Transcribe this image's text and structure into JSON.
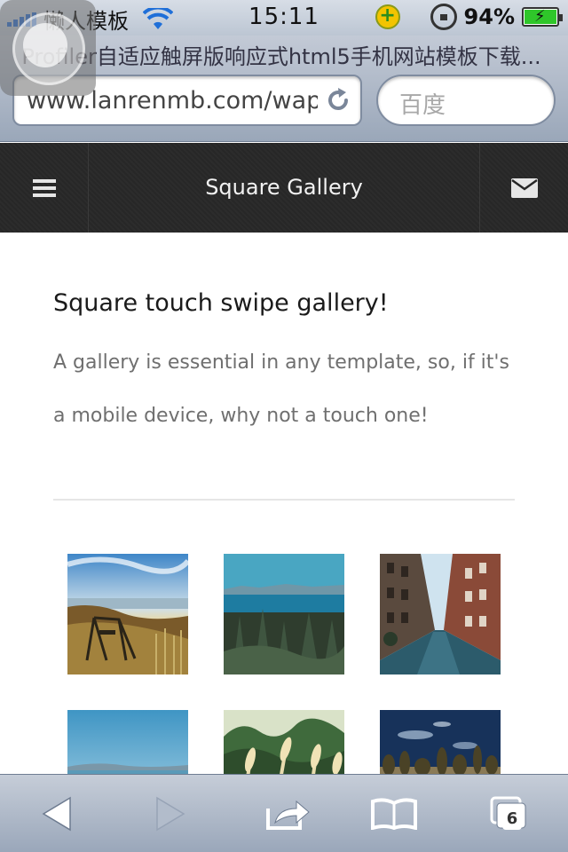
{
  "status_bar": {
    "carrier": "懒人模板",
    "time": "15:11",
    "battery": "94%"
  },
  "browser": {
    "page_title": "Profiler自适应触屏版响应式html5手机网站模板下载...",
    "url": "www.lanrenmb.com/wap",
    "search_placeholder": "百度",
    "tabs_count": "6"
  },
  "header": {
    "title": "Square Gallery",
    "menu_icon": "menu-icon",
    "mail_icon": "mail-icon"
  },
  "main": {
    "heading": "Square touch swipe gallery!",
    "description": "A gallery is essential in any template, so, if it's a mobile device, why not a touch one!"
  },
  "gallery": {
    "items": [
      {
        "subject": "swing on grassy coast at sunset"
      },
      {
        "subject": "lake and pine forest"
      },
      {
        "subject": "city street between brick buildings"
      },
      {
        "subject": "sea horizon under blue sky"
      },
      {
        "subject": "grass stalks against blurred trees"
      },
      {
        "subject": "trees under dark blue sky"
      }
    ]
  },
  "colors": {
    "header_bg": "#272727",
    "toolbar_blue": "#9aa7ba",
    "body_text": "#6f6f6f"
  }
}
